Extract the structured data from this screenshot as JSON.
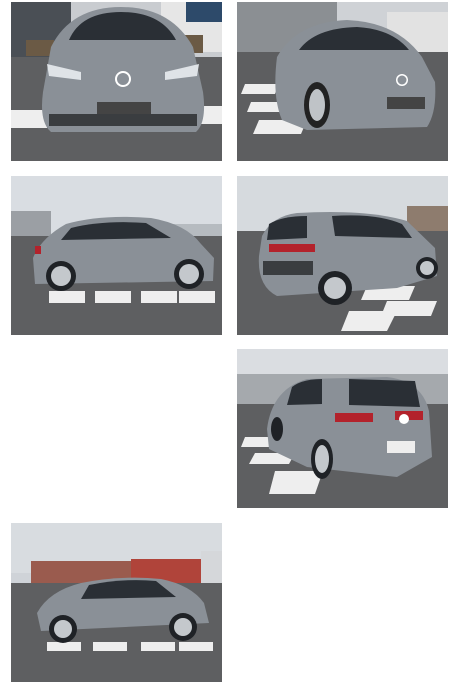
{
  "gallery": {
    "photos": [
      {
        "view": "front",
        "alt": ""
      },
      {
        "view": "front-three-quarter",
        "alt": ""
      },
      {
        "view": "side-left",
        "alt": ""
      },
      {
        "view": "rear-three-quarter-right",
        "alt": ""
      },
      {
        "view": "rear-three-quarter-left",
        "alt": ""
      },
      {
        "view": "side-left-far",
        "alt": ""
      }
    ]
  },
  "colors": {
    "car_body": "#8a9097",
    "sky": "#d9dde2",
    "asphalt": "#5e5f61",
    "markings": "#eeeeee",
    "glass": "#2a2f35",
    "taillight": "#b3222b"
  }
}
